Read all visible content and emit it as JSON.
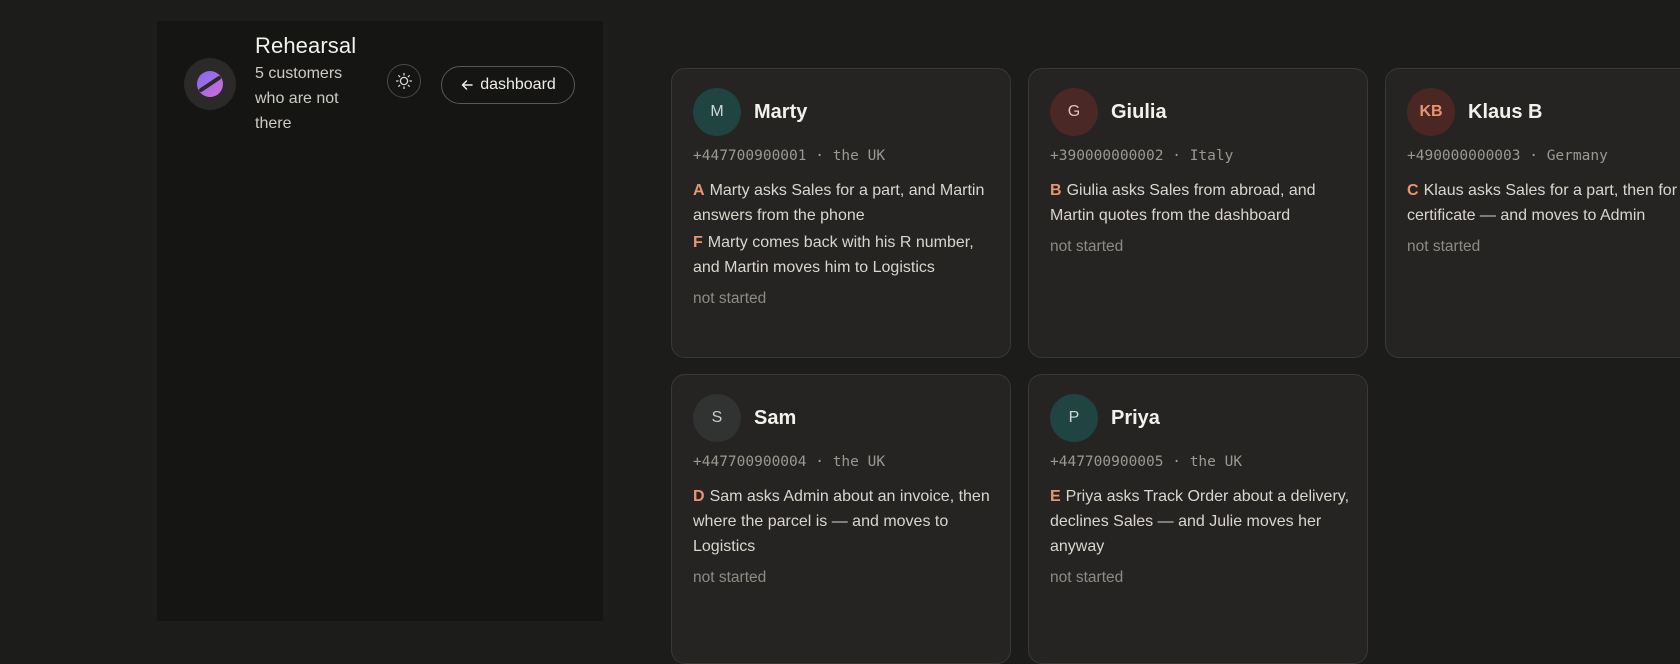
{
  "app": {
    "title": "Rehearsal",
    "subtitle": "5 customers who are not there",
    "theme_icon": "sun-icon",
    "dashboard_label": "dashboard",
    "back_icon": "arrow-left-icon"
  },
  "customers": [
    {
      "initials": "M",
      "name": "Marty",
      "phone": "+447700900001",
      "country": "the UK",
      "avatar_bg": "#1f4442",
      "avatar_fg": "#cfd9d6",
      "scenarios": [
        {
          "letter": "A",
          "text": "Marty asks Sales for a part, and Martin answers from the phone"
        },
        {
          "letter": "F",
          "text": "Marty comes back with his R number, and Martin moves him to Logistics"
        }
      ],
      "status": "not started"
    },
    {
      "initials": "G",
      "name": "Giulia",
      "phone": "+390000000002",
      "country": "Italy",
      "avatar_bg": "#4a2826",
      "avatar_fg": "#d9c5c2",
      "scenarios": [
        {
          "letter": "B",
          "text": "Giulia asks Sales from abroad, and Martin quotes from the dashboard"
        }
      ],
      "status": "not started"
    },
    {
      "initials": "KB",
      "name": "Klaus B",
      "phone": "+490000000003",
      "country": "Germany",
      "avatar_bg": "#4b2724",
      "avatar_fg": "#e79570",
      "scenarios": [
        {
          "letter": "C",
          "text": "Klaus asks Sales for a part, then for a certificate — and moves to Admin"
        }
      ],
      "status": "not started"
    },
    {
      "initials": "S",
      "name": "Sam",
      "phone": "+447700900004",
      "country": "the UK",
      "avatar_bg": "#303331",
      "avatar_fg": "#c9ccc9",
      "scenarios": [
        {
          "letter": "D",
          "text": "Sam asks Admin about an invoice, then where the parcel is — and moves to Logistics"
        }
      ],
      "status": "not started"
    },
    {
      "initials": "P",
      "name": "Priya",
      "phone": "+447700900005",
      "country": "the UK",
      "avatar_bg": "#1f4442",
      "avatar_fg": "#cfd9d6",
      "scenarios": [
        {
          "letter": "E",
          "text": "Priya asks Track Order about a delivery, declines Sales — and Julie moves her anyway"
        }
      ],
      "status": "not started"
    }
  ]
}
